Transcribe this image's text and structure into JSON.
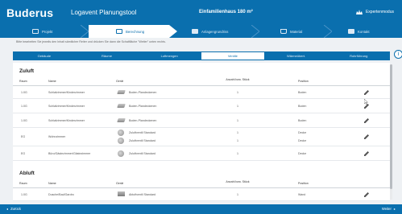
{
  "header": {
    "brand": "Buderus",
    "app_title": "Logavent Planungstool",
    "project_title": "Einfamilienhaus 180 m²",
    "experts_label": "Expertenmodus"
  },
  "steps": [
    {
      "label": "Projekt",
      "active": false
    },
    {
      "label": "Berechnung",
      "active": true
    },
    {
      "label": "Anlagengrundriss",
      "active": false
    },
    {
      "label": "Material",
      "active": false
    },
    {
      "label": "Kontakt",
      "active": false
    }
  ],
  "info_text": "Bitte bearbeiten Sie jeweils den Inhalt sämtlicher Reiter und drücken Sie dann die Schaltfläche \"Weiter\" unten rechts.",
  "tabs": [
    {
      "label": "Gebäude",
      "active": false
    },
    {
      "label": "Räume",
      "active": false
    },
    {
      "label": "Luftmengen",
      "active": false
    },
    {
      "label": "Ventile",
      "active": true
    },
    {
      "label": "Wärmeübert.",
      "active": false
    },
    {
      "label": "Rohrführung",
      "active": false
    }
  ],
  "columns": {
    "raum": "Raum",
    "name": "Name",
    "geraet": "Gerät",
    "anzahl": "Anzahl bzw. Stück",
    "position": "Position"
  },
  "zuluft": {
    "title": "Zuluft",
    "rows": [
      {
        "raum": "1.0G",
        "name": "Schlafzimmer/Kinderzimmer",
        "geraet": "Boden-Plandeckenen",
        "icon": "grille",
        "anzahl": "1",
        "position": "Boden"
      },
      {
        "raum": "1.0G",
        "name": "Schlafzimmer/Kinderzimmer",
        "geraet": "Boden-Plandeckenen",
        "icon": "grille",
        "anzahl": "1",
        "position": "Boden"
      },
      {
        "raum": "1.0G",
        "name": "Schlafzimmer/Kinderzimmer",
        "geraet": "Boden-Plandeckenen",
        "icon": "grille",
        "anzahl": "1",
        "position": "Boden"
      },
      {
        "raum": "EG",
        "name": "Wohnzimmer",
        "geraet": "Zuluftventil Standard",
        "geraet2": "Zuluftventil Standard",
        "icon": "disc",
        "anzahl": "1",
        "anzahl2": "1",
        "position": "Decke",
        "position2": "Decke"
      },
      {
        "raum": "EG",
        "name": "Büro/Gästezimmer/Gästezimmer",
        "geraet": "Zuluftventil Standard",
        "icon": "disc",
        "anzahl": "1",
        "position": "Decke"
      }
    ]
  },
  "abluft": {
    "title": "Abluft",
    "rows": [
      {
        "raum": "1.0G",
        "name": "Dusche/Bad/Gardro",
        "geraet": "Abluftventil Standard",
        "icon": "box",
        "anzahl": "1",
        "position": "Wand"
      }
    ]
  },
  "footer": {
    "back_label": "Zurück",
    "next_label": "Weiter"
  },
  "colors": {
    "brand_blue": "#0a6fae",
    "panel_bg": "#ffffff",
    "page_bg": "#eef1f4"
  }
}
